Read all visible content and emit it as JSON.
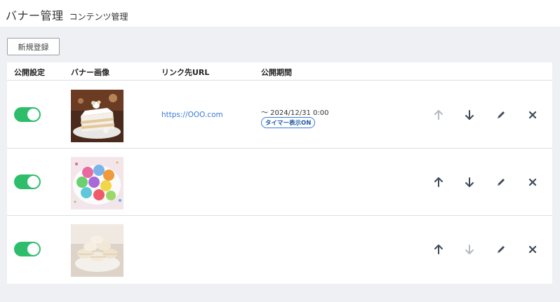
{
  "header": {
    "title": "バナー管理",
    "subtitle": "コンテンツ管理"
  },
  "toolbar": {
    "new_label": "新規登録"
  },
  "columns": {
    "public": "公開設定",
    "image": "バナー画像",
    "link": "リンク先URL",
    "period": "公開期間"
  },
  "rows": [
    {
      "enabled": true,
      "image": "cake-icon",
      "link": "https://OOO.com",
      "period": "〜 2024/12/31 0:00",
      "badge": "タイマー表示ON",
      "up_enabled": false,
      "down_enabled": true
    },
    {
      "enabled": true,
      "image": "macaron-plate-icon",
      "link": "",
      "period": "",
      "badge": "",
      "up_enabled": true,
      "down_enabled": true
    },
    {
      "enabled": true,
      "image": "macaron-stack-icon",
      "link": "",
      "period": "",
      "badge": "",
      "up_enabled": true,
      "down_enabled": false
    }
  ],
  "colors": {
    "toggle_on": "#2ebd6b",
    "link": "#3a7bd5",
    "icon_active": "#3f4a59",
    "icon_disabled": "#b4bac2",
    "page_bg": "#eef0f3"
  }
}
